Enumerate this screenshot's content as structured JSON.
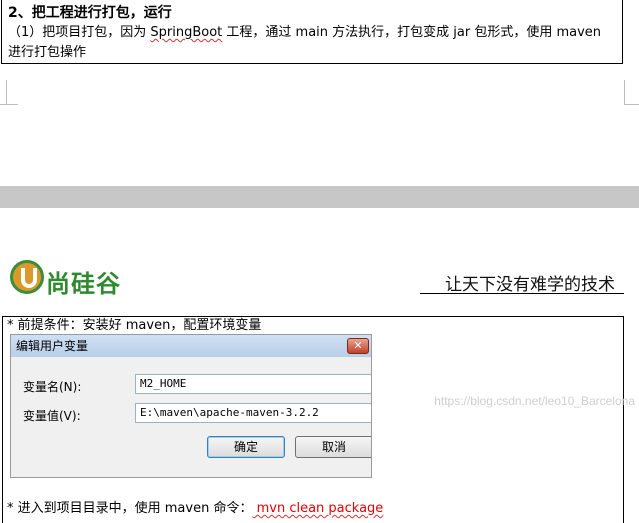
{
  "section1": {
    "heading": "2、把工程进行打包，运行",
    "para_prefix": "（1）把项目打包，因为 ",
    "para_spell": "SpringBoot",
    "para_suffix": " 工程，通过 main 方法执行，打包变成 jar 包形式，使用 maven 进行打包操作"
  },
  "logo": {
    "brand": "尚硅谷"
  },
  "slogan": "让天下没有难学的技术",
  "bullet1": "* 前提条件：安装好 maven，配置环境变量",
  "dialog": {
    "title": "编辑用户变量",
    "close": "✕",
    "name_label": "变量名(N):",
    "name_value": "M2_HOME",
    "value_label": "变量值(V):",
    "value_value": "E:\\maven\\apache-maven-3.2.2",
    "ok_label": "确定",
    "cancel_label": "取消"
  },
  "bullet2": {
    "prefix": "* 进入到项目目录中，使用 maven 命令：",
    "command": " mvn clean package"
  },
  "watermark": "https://blog.csdn.net/leo10_Barcelona",
  "colors": {
    "brand_green": "#2f8a2f",
    "brand_orange": "#d99a2b",
    "command_red": "#e00000"
  }
}
